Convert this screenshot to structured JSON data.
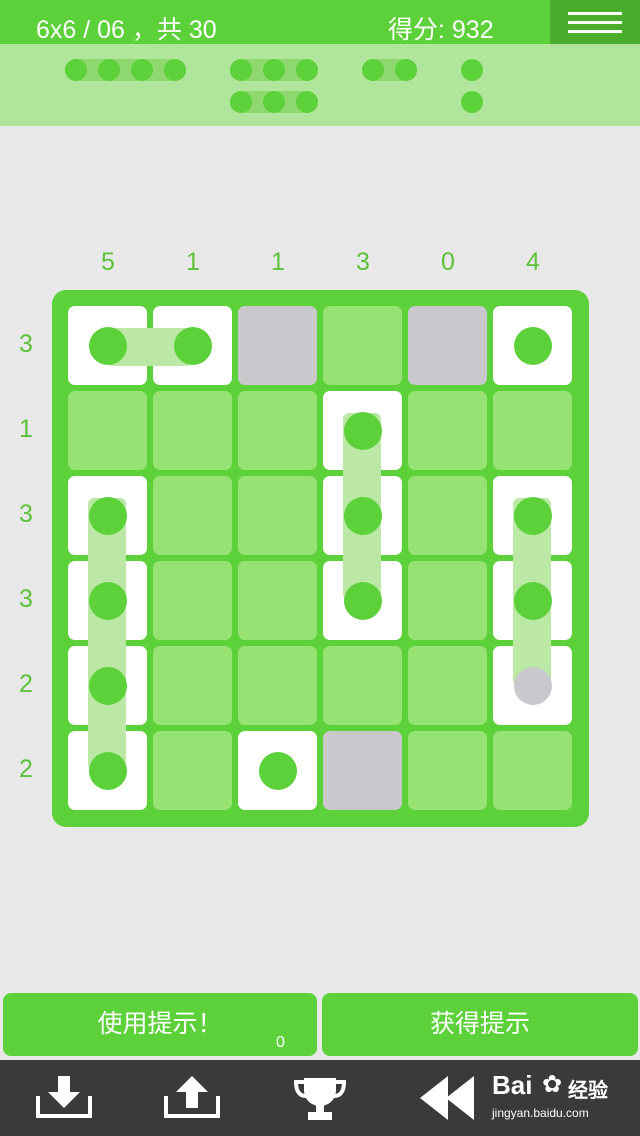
{
  "header": {
    "level_text": "6x6 / 06 ，共 30",
    "score_text": "得分: 932",
    "menu_icon": "hamburger-menu-icon"
  },
  "remaining_pieces": [
    {
      "length": 4,
      "count": 1
    },
    {
      "length": 3,
      "count": 2
    },
    {
      "length": 2,
      "count": 1
    },
    {
      "length": 1,
      "count": 2
    }
  ],
  "board": {
    "size": 6,
    "column_clues": [
      "5",
      "1",
      "1",
      "3",
      "0",
      "4"
    ],
    "row_clues": [
      "3",
      "1",
      "3",
      "3",
      "2",
      "2"
    ],
    "rows": [
      [
        "ship",
        "ship",
        "wall",
        "empty",
        "wall",
        "ship"
      ],
      [
        "empty",
        "empty",
        "empty",
        "ship",
        "empty",
        "empty"
      ],
      [
        "ship",
        "empty",
        "empty",
        "ship",
        "empty",
        "ship"
      ],
      [
        "ship",
        "empty",
        "empty",
        "ship",
        "empty",
        "ship"
      ],
      [
        "ship",
        "empty",
        "empty",
        "empty",
        "empty",
        "ship-grey"
      ],
      [
        "ship",
        "empty",
        "ship",
        "wall",
        "empty",
        "empty"
      ]
    ],
    "colors": {
      "board": "#5cd13a",
      "empty": "#96e272",
      "wall": "#c8c8cd",
      "ship": "#ffffff"
    }
  },
  "buttons": {
    "use_hint": "使用提示！",
    "hint_count": "0",
    "get_hint": "获得提示"
  },
  "toolbar": {
    "icons": [
      "download-icon",
      "upload-icon",
      "trophy-icon",
      "rewind-icon"
    ]
  },
  "watermark": {
    "logo": "Bai",
    "logo2": "经验",
    "url": "jingyan.baidu.com"
  }
}
